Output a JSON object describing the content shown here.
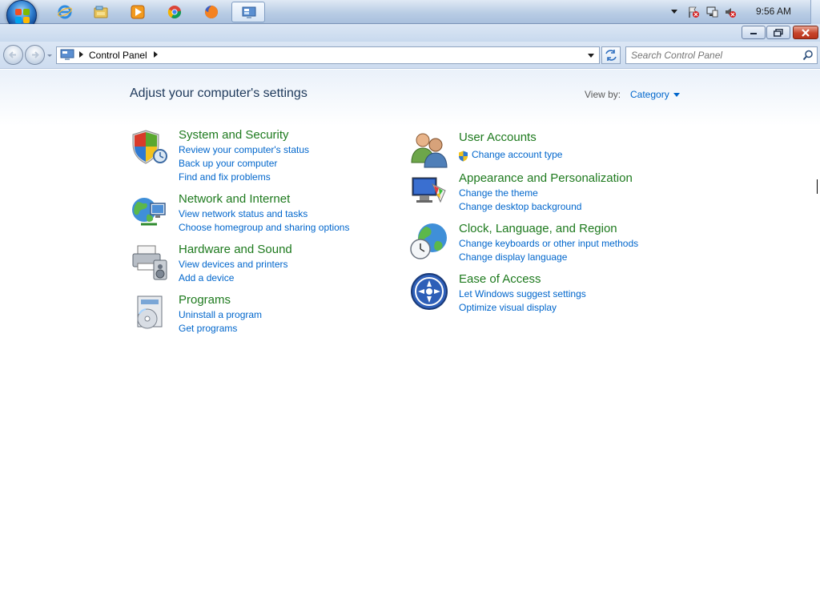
{
  "taskbar": {
    "clock": "9:56 AM",
    "apps": [
      "internet-explorer",
      "windows-explorer",
      "media-player",
      "chrome",
      "firefox",
      "control-panel"
    ]
  },
  "window": {
    "address": {
      "crumb": "Control Panel"
    },
    "search": {
      "placeholder": "Search Control Panel"
    }
  },
  "main": {
    "title": "Adjust your computer's settings",
    "view_by_label": "View by:",
    "view_by_value": "Category",
    "categories_left": [
      {
        "title": "System and Security",
        "links": [
          "Review your computer's status",
          "Back up your computer",
          "Find and fix problems"
        ]
      },
      {
        "title": "Network and Internet",
        "links": [
          "View network status and tasks",
          "Choose homegroup and sharing options"
        ]
      },
      {
        "title": "Hardware and Sound",
        "links": [
          "View devices and printers",
          "Add a device"
        ]
      },
      {
        "title": "Programs",
        "links": [
          "Uninstall a program",
          "Get programs"
        ]
      }
    ],
    "categories_right": [
      {
        "title": "User Accounts",
        "links": [
          "Change account type"
        ]
      },
      {
        "title": "Appearance and Personalization",
        "links": [
          "Change the theme",
          "Change desktop background"
        ]
      },
      {
        "title": "Clock, Language, and Region",
        "links": [
          "Change keyboards or other input methods",
          "Change display language"
        ]
      },
      {
        "title": "Ease of Access",
        "links": [
          "Let Windows suggest settings",
          "Optimize visual display"
        ]
      }
    ]
  },
  "colors": {
    "category_title": "#1e7a1e",
    "link": "#0066cc",
    "heading": "#1e395b"
  }
}
